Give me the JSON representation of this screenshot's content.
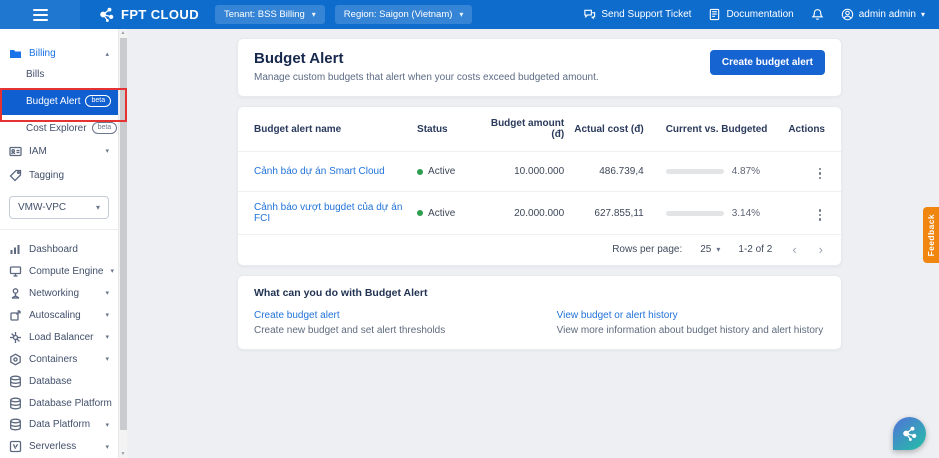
{
  "topbar": {
    "logo": "FPT CLOUD",
    "tenant": "Tenant: BSS Billing",
    "region": "Region: Saigon (Vietnam)",
    "support": "Send Support Ticket",
    "documentation": "Documentation",
    "user": "admin admin"
  },
  "sidebar": {
    "billing": "Billing",
    "bills": "Bills",
    "budget_alert": "Budget Alert",
    "cost_explorer": "Cost Explorer",
    "beta_badge": "beta",
    "iam": "IAM",
    "tagging": "Tagging",
    "vpc_selected": "VMW-VPC",
    "dashboard": "Dashboard",
    "compute_engine": "Compute Engine",
    "networking": "Networking",
    "autoscaling": "Autoscaling",
    "load_balancer": "Load Balancer",
    "containers": "Containers",
    "database": "Database",
    "database_platform": "Database Platform",
    "data_platform": "Data Platform",
    "serverless": "Serverless"
  },
  "page": {
    "title": "Budget Alert",
    "subtitle": "Manage custom budgets that alert when your costs exceed budgeted amount.",
    "create_button": "Create budget alert"
  },
  "table": {
    "headers": {
      "name": "Budget alert name",
      "status": "Status",
      "budget": "Budget amount (đ)",
      "actual": "Actual cost (đ)",
      "current": "Current vs. Budgeted",
      "actions": "Actions"
    },
    "rows": [
      {
        "name": "Cảnh báo dự án Smart Cloud",
        "status": "Active",
        "budget": "10.000.000",
        "actual": "486.739,4",
        "percent": "4.87%",
        "percent_value": 4.87
      },
      {
        "name": "Cảnh báo vượt bugdet của dự án FCI",
        "status": "Active",
        "budget": "20.000.000",
        "actual": "627.855,11",
        "percent": "3.14%",
        "percent_value": 3.14
      }
    ],
    "pagination": {
      "rows_per_page_label": "Rows per page:",
      "rows_per_page_value": "25",
      "range": "1-2 of 2"
    }
  },
  "info": {
    "title": "What can you do with Budget Alert",
    "items": [
      {
        "link": "Create budget alert",
        "desc": "Create new budget and set alert thresholds"
      },
      {
        "link": "View budget or alert history",
        "desc": "View more information about budget history and alert history"
      }
    ]
  },
  "floating": {
    "feedback": "Feedback"
  },
  "icons": {
    "caret_down": "▾",
    "chevron_up": "▴",
    "chevron_down": "▾",
    "prev": "‹",
    "next": "›",
    "scroll_up": "▲",
    "scroll_down": "▼"
  },
  "colors": {
    "topbar_blue": "#0e6ccd",
    "accent_blue": "#1663d2",
    "link_blue": "#2273d9",
    "active_green": "#2e9e4f",
    "feedback_orange": "#f0860f",
    "annotation_red": "#e53333"
  }
}
